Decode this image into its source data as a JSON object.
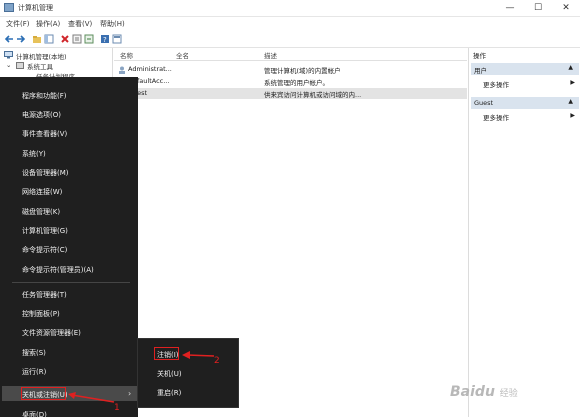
{
  "window": {
    "title": "计算机管理",
    "controls": {
      "minimize": "—",
      "maximize": "☐",
      "close": "✕"
    }
  },
  "menubar": [
    "文件(F)",
    "操作(A)",
    "查看(V)",
    "帮助(H)"
  ],
  "toolbar": {
    "icons": [
      "back-arrow-icon",
      "forward-arrow-icon",
      "folder-icon",
      "pane-icon",
      "delete-icon",
      "properties-icon",
      "export-icon",
      "help-icon",
      "console-icon"
    ]
  },
  "tree": {
    "root": "计算机管理(本地)",
    "child": "系统工具",
    "grandchild": "任务计划程序"
  },
  "list": {
    "headers": [
      "名称",
      "全名",
      "描述"
    ],
    "rows": [
      {
        "name": "Administrat...",
        "fullname": "",
        "desc": "管理计算机(域)的内置帐户"
      },
      {
        "name": "DefaultAcc...",
        "fullname": "",
        "desc": "系统管理的用户帐户。"
      },
      {
        "name": "Guest",
        "fullname": "",
        "desc": "供来宾访问计算机或访问域的内..."
      }
    ]
  },
  "actions": {
    "header": "操作",
    "sections": [
      {
        "title": "用户",
        "item": "更多操作"
      },
      {
        "title": "Guest",
        "item": "更多操作"
      }
    ]
  },
  "winx_menu": {
    "items": [
      "程序和功能(F)",
      "电源选项(O)",
      "事件查看器(V)",
      "系统(Y)",
      "设备管理器(M)",
      "网络连接(W)",
      "磁盘管理(K)",
      "计算机管理(G)",
      "命令提示符(C)",
      "命令提示符(管理员)(A)",
      "任务管理器(T)",
      "控制面板(P)",
      "文件资源管理器(E)",
      "搜索(S)",
      "运行(R)",
      "关机或注销(U)",
      "桌面(D)"
    ],
    "submenu_arrow": "›",
    "submenu": [
      "注销(I)",
      "关机(U)",
      "重启(R)"
    ]
  },
  "annotations": {
    "step1": "1",
    "step2": "2",
    "color": "#e02020"
  },
  "watermark": {
    "brand": "Baidu",
    "sub": "经验"
  }
}
